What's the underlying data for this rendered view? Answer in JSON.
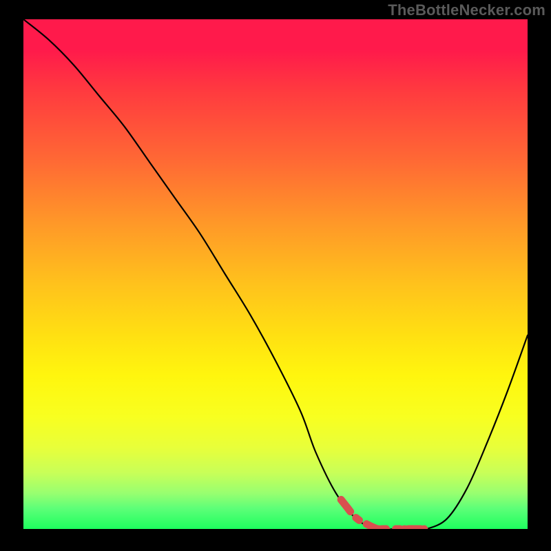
{
  "watermark": "TheBottleNecker.com",
  "chart_data": {
    "type": "line",
    "title": "",
    "xlabel": "",
    "ylabel": "",
    "xlim": [
      0,
      100
    ],
    "ylim": [
      0,
      100
    ],
    "series": [
      {
        "name": "bottleneck-curve",
        "x": [
          0,
          5,
          10,
          15,
          20,
          25,
          30,
          35,
          40,
          45,
          50,
          55,
          58,
          62,
          66,
          70,
          74,
          78,
          80,
          84,
          88,
          92,
          96,
          100
        ],
        "y": [
          100,
          96,
          91,
          85,
          79,
          72,
          65,
          58,
          50,
          42,
          33,
          23,
          15,
          7,
          2,
          0,
          0,
          0,
          0,
          2,
          8,
          17,
          27,
          38
        ]
      }
    ],
    "highlight_region": {
      "name": "bottom-red-segment",
      "x": [
        63,
        80
      ],
      "color": "#d94f4f"
    },
    "background_gradient": {
      "top": "#ff1a4b",
      "bottom": "#1eff5e"
    }
  }
}
